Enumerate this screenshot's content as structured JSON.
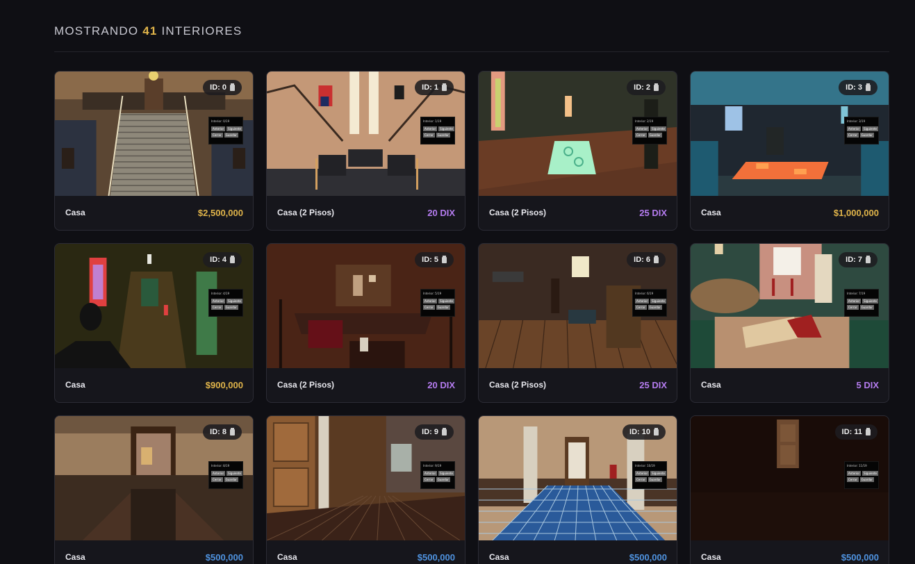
{
  "header": {
    "prefix": "MOSTRANDO",
    "count": "41",
    "suffix": "INTERIORES"
  },
  "colors": {
    "gold": "#e0b44a",
    "purple": "#b57cf0",
    "blue": "#4f93e0"
  },
  "hud": {
    "previous": "Anterior",
    "next": "Siguiente",
    "close": "Cerrar",
    "save": "Guardar"
  },
  "cards": [
    {
      "id": "ID: 0",
      "name": "Casa",
      "price": "$2,500,000",
      "price_color": "#e0b44a",
      "hud_text": "Interior: 0/19",
      "scene": "stairs-hall"
    },
    {
      "id": "ID: 1",
      "name": "Casa (2 Pisos)",
      "price": "20 DIX",
      "price_color": "#b57cf0",
      "hud_text": "Interior: 1/19",
      "scene": "grand-lobby"
    },
    {
      "id": "ID: 2",
      "name": "Casa (2 Pisos)",
      "price": "25 DIX",
      "price_color": "#b57cf0",
      "hud_text": "Interior: 2/19",
      "scene": "dark-room-mint-rug"
    },
    {
      "id": "ID: 3",
      "name": "Casa",
      "price": "$1,000,000",
      "price_color": "#e0b44a",
      "hud_text": "Interior: 3/19",
      "scene": "teal-room-orange-rug"
    },
    {
      "id": "ID: 4",
      "name": "Casa",
      "price": "$900,000",
      "price_color": "#e0b44a",
      "hud_text": "Interior: 4/19",
      "scene": "olive-corridor"
    },
    {
      "id": "ID: 5",
      "name": "Casa (2 Pisos)",
      "price": "20 DIX",
      "price_color": "#b57cf0",
      "hud_text": "Interior: 5/19",
      "scene": "red-upper-floor"
    },
    {
      "id": "ID: 6",
      "name": "Casa (2 Pisos)",
      "price": "25 DIX",
      "price_color": "#b57cf0",
      "hud_text": "Interior: 6/19",
      "scene": "wooden-living"
    },
    {
      "id": "ID: 7",
      "name": "Casa",
      "price": "5 DIX",
      "price_color": "#b57cf0",
      "hud_text": "Interior: 7/19",
      "scene": "green-lounge"
    },
    {
      "id": "ID: 8",
      "name": "Casa",
      "price": "$500,000",
      "price_color": "#4f93e0",
      "hud_text": "Interior: 8/19",
      "scene": "beige-doorway"
    },
    {
      "id": "ID: 9",
      "name": "Casa",
      "price": "$500,000",
      "price_color": "#4f93e0",
      "hud_text": "Interior: 9/19",
      "scene": "brown-tile-hall"
    },
    {
      "id": "ID: 10",
      "name": "Casa",
      "price": "$500,000",
      "price_color": "#4f93e0",
      "hud_text": "Interior: 10/19",
      "scene": "blue-tile-hall"
    },
    {
      "id": "ID: 11",
      "name": "Casa",
      "price": "$500,000",
      "price_color": "#4f93e0",
      "hud_text": "Interior: 11/19",
      "scene": "dark-red-room"
    }
  ]
}
